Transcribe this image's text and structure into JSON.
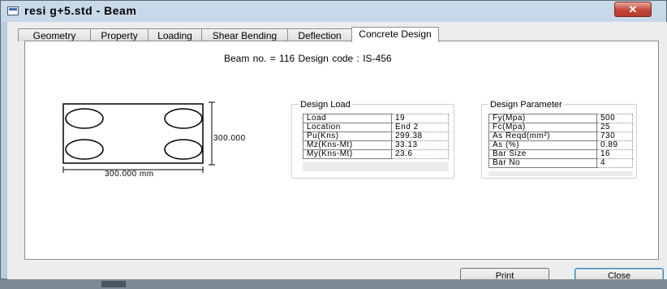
{
  "window": {
    "title": "resi g+5.std - Beam",
    "close_glyph": "✕"
  },
  "tabs": [
    {
      "label": "Geometry",
      "active": false
    },
    {
      "label": "Property",
      "active": false
    },
    {
      "label": "Loading",
      "active": false
    },
    {
      "label": "Shear Bending",
      "active": false
    },
    {
      "label": "Deflection",
      "active": false
    },
    {
      "label": "Concrete Design",
      "active": true
    }
  ],
  "header": {
    "text": "Beam no. = 116  Design code :  IS-456"
  },
  "section": {
    "height_label": "300.000",
    "width_label": "300.000 mm",
    "bars": 4
  },
  "design_load": {
    "title": "Design Load",
    "rows": [
      {
        "key": "Load",
        "value": "19"
      },
      {
        "key": "Location",
        "value": "End 2"
      },
      {
        "key": "Pu(Kns)",
        "value": "299.38"
      },
      {
        "key": "Mz(Kns-Mt)",
        "value": "33.13"
      },
      {
        "key": "My(Kns-Mt)",
        "value": "23.6"
      }
    ]
  },
  "design_parameter": {
    "title": "Design Parameter",
    "rows": [
      {
        "key": "Fy(Mpa)",
        "value": "500"
      },
      {
        "key": "Fc(Mpa)",
        "value": "25"
      },
      {
        "key": "As Reqd(mm²)",
        "value": "730"
      },
      {
        "key": "As (%)",
        "value": "0.89"
      },
      {
        "key": "Bar Size",
        "value": "16"
      },
      {
        "key": "Bar No",
        "value": "4"
      }
    ]
  },
  "buttons": {
    "print": "Print",
    "close": "Close"
  },
  "colors": {
    "titlebar": "#c9d9ea",
    "close_button": "#c4473a",
    "default_button_border": "#3c7fb1"
  }
}
